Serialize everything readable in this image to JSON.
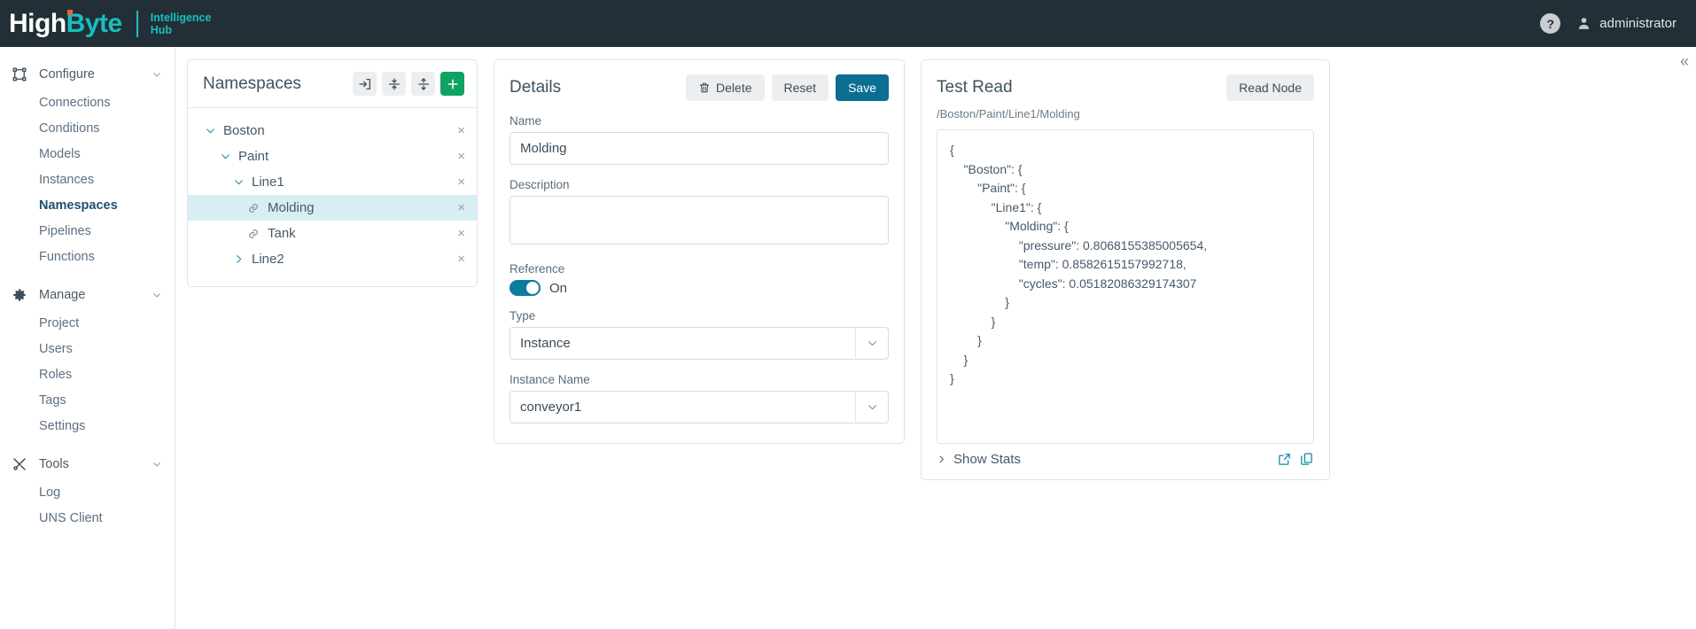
{
  "header": {
    "logo": {
      "part1": "High",
      "part2": "Byte",
      "sub_line1": "Intelligence",
      "sub_line2": "Hub"
    },
    "help_icon": "question-mark-icon",
    "user_name": "administrator"
  },
  "sidebar": {
    "groups": [
      {
        "label": "Configure",
        "icon": "configure-frame-icon",
        "items": [
          {
            "label": "Connections",
            "active": false
          },
          {
            "label": "Conditions",
            "active": false
          },
          {
            "label": "Models",
            "active": false
          },
          {
            "label": "Instances",
            "active": false
          },
          {
            "label": "Namespaces",
            "active": true
          },
          {
            "label": "Pipelines",
            "active": false
          },
          {
            "label": "Functions",
            "active": false
          }
        ]
      },
      {
        "label": "Manage",
        "icon": "gear-icon",
        "items": [
          {
            "label": "Project",
            "active": false
          },
          {
            "label": "Users",
            "active": false
          },
          {
            "label": "Roles",
            "active": false
          },
          {
            "label": "Tags",
            "active": false
          },
          {
            "label": "Settings",
            "active": false
          }
        ]
      },
      {
        "label": "Tools",
        "icon": "tools-icon",
        "items": [
          {
            "label": "Log",
            "active": false
          },
          {
            "label": "UNS Client",
            "active": false
          }
        ]
      }
    ]
  },
  "namespaces": {
    "title": "Namespaces",
    "toolbar": [
      {
        "name": "import-icon",
        "label": "Import"
      },
      {
        "name": "collapse-all-icon",
        "label": "Collapse All"
      },
      {
        "name": "expand-all-icon",
        "label": "Expand All"
      },
      {
        "name": "add-icon",
        "label": "Add"
      }
    ],
    "tree": [
      {
        "label": "Boston",
        "depth": 0,
        "caret": "down",
        "icon": "none",
        "selected": false,
        "close": "×"
      },
      {
        "label": "Paint",
        "depth": 1,
        "caret": "down",
        "icon": "none",
        "selected": false,
        "close": "×"
      },
      {
        "label": "Line1",
        "depth": 2,
        "caret": "down",
        "icon": "none",
        "selected": false,
        "close": "×"
      },
      {
        "label": "Molding",
        "depth": 3,
        "caret": "none",
        "icon": "link",
        "selected": true,
        "close": "×"
      },
      {
        "label": "Tank",
        "depth": 3,
        "caret": "none",
        "icon": "link",
        "selected": false,
        "close": "×"
      },
      {
        "label": "Line2",
        "depth": 1,
        "caret": "right",
        "icon": "none",
        "selected": false,
        "close": "×"
      }
    ]
  },
  "details": {
    "title": "Details",
    "delete_label": "Delete",
    "reset_label": "Reset",
    "save_label": "Save",
    "name_label": "Name",
    "name_value": "Molding",
    "description_label": "Description",
    "description_value": "",
    "description_placeholder": "",
    "reference_label": "Reference",
    "reference_state": "On",
    "type_label": "Type",
    "type_value": "Instance",
    "instance_name_label": "Instance Name",
    "instance_name_value": "conveyor1"
  },
  "test_read": {
    "title": "Test Read",
    "read_node_label": "Read Node",
    "path": "/Boston/Paint/Line1/Molding",
    "output": "{\n    \"Boston\": {\n        \"Paint\": {\n            \"Line1\": {\n                \"Molding\": {\n                    \"pressure\": 0.8068155385005654,\n                    \"temp\": 0.8582615157992718,\n                    \"cycles\": 0.05182086329174307\n                }\n            }\n        }\n    }\n}",
    "show_stats_label": "Show Stats",
    "footer_icons": [
      {
        "name": "open-external-icon"
      },
      {
        "name": "copy-icon"
      }
    ]
  },
  "colors": {
    "header_bg": "#222f37",
    "brand_teal": "#17bfc0",
    "accent_orange": "#e8603c",
    "primary_blue": "#0b6e93",
    "green": "#0fa263",
    "selected_row": "#d7eff2"
  }
}
